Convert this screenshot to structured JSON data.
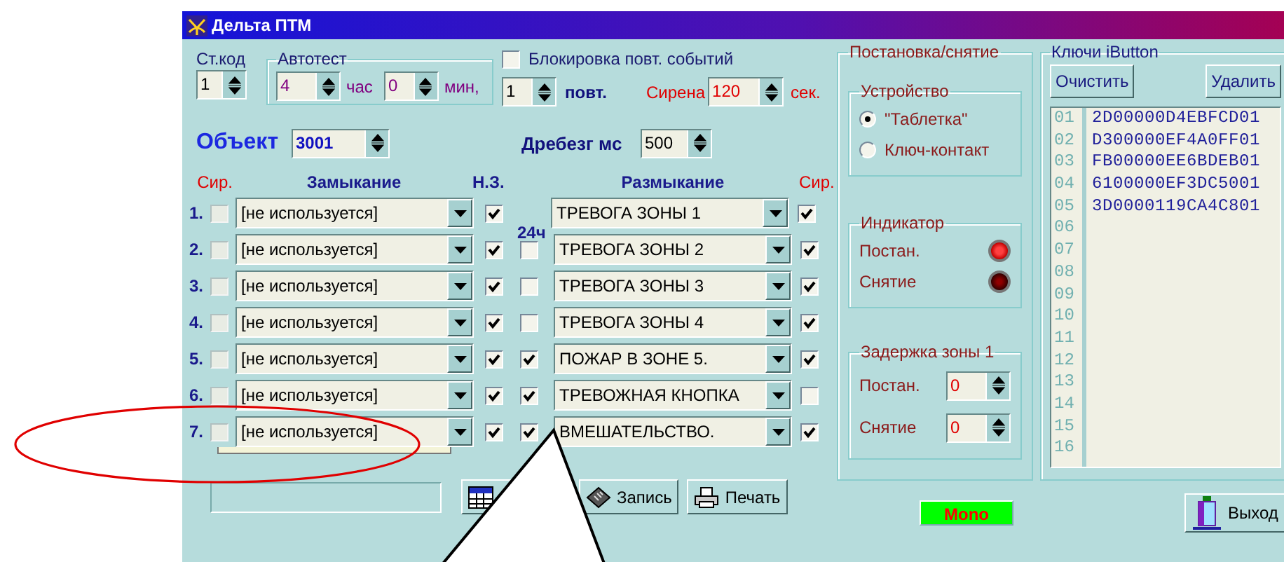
{
  "window": {
    "title": "Дельта ПТМ"
  },
  "station_code": {
    "label": "Ст.код",
    "value": "1"
  },
  "autotest": {
    "title": "Автотест",
    "hours": "4",
    "hours_unit": "час",
    "minutes": "0",
    "minutes_unit": "мин,"
  },
  "block_repeats": {
    "label": "Блокировка повт. событий",
    "checked": false
  },
  "repeats": {
    "value": "1",
    "unit": "повт."
  },
  "siren": {
    "label": "Сирена",
    "value": "120",
    "unit": "сек."
  },
  "object": {
    "label": "Объект",
    "value": "3001"
  },
  "debounce": {
    "label": "Дребезг мс",
    "value": "500"
  },
  "zones": {
    "headers": {
      "siren_closing": "Сир.",
      "closing": "Замыкание",
      "normally_closed": "Н.З.",
      "opening": "Размыкание",
      "siren_opening": "Сир.",
      "h24": "24ч"
    },
    "rows": [
      {
        "number": "1.",
        "siren_closing": false,
        "closing": "[не используется]",
        "open": false,
        "normally_closed": true,
        "opening": "ТРЕВОГА ЗОНЫ 1",
        "siren_opening": true
      },
      {
        "number": "2.",
        "siren_closing": false,
        "closing": "[не используется]",
        "open": false,
        "normally_closed": true,
        "h24": false,
        "opening": "ТРЕВОГА ЗОНЫ 2",
        "siren_opening": true
      },
      {
        "number": "3.",
        "siren_closing": false,
        "closing": "[не используется]",
        "open": false,
        "normally_closed": true,
        "h24": false,
        "opening": "ТРЕВОГА ЗОНЫ 3",
        "siren_opening": true
      },
      {
        "number": "4.",
        "siren_closing": false,
        "closing": "[не используется]",
        "open": false,
        "normally_closed": true,
        "h24": false,
        "opening": "ТРЕВОГА ЗОНЫ 4",
        "siren_opening": true
      },
      {
        "number": "5.",
        "siren_closing": false,
        "closing": "[не используется]",
        "open": false,
        "normally_closed": true,
        "h24": true,
        "opening": "ПОЖАР В ЗОНЕ 5.",
        "siren_opening": true
      },
      {
        "number": "6.",
        "siren_closing": false,
        "closing": "[не используется]",
        "open": false,
        "normally_closed": true,
        "h24": true,
        "opening": "ТРЕВОЖНАЯ КНОПКА",
        "siren_opening": false
      },
      {
        "number": "7.",
        "siren_closing": false,
        "closing": "[не используется]",
        "open": true,
        "normally_closed": true,
        "h24": true,
        "opening": "ВМЕШАТЕЛЬСТВО.",
        "siren_opening": true
      }
    ]
  },
  "toolbar": [
    {
      "kind": "table"
    },
    {
      "kind": "record",
      "label": "Запись"
    },
    {
      "kind": "print",
      "label": "Печать"
    }
  ],
  "arming": {
    "title": "Постановка/снятие",
    "device": {
      "title": "Устройство",
      "options": [
        {
          "label": "\"Таблетка\"",
          "selected": true
        },
        {
          "label": "Ключ-контакт",
          "selected": false
        }
      ]
    },
    "indicator": {
      "title": "Индикатор",
      "lamps": [
        {
          "label": "Постан.",
          "on": true
        },
        {
          "label": "Снятие",
          "on": false
        }
      ]
    },
    "zone_delay": {
      "title": "Задержка зоны 1",
      "fields": [
        {
          "label": "Постан.",
          "value": "0"
        },
        {
          "label": "Снятие",
          "value": "0"
        }
      ]
    }
  },
  "keys": {
    "title": "Ключи iButton",
    "buttons": [
      "Очистить",
      "Удалить"
    ],
    "lines": [
      {
        "number": "01",
        "code": "2D00000D4EBFCD01"
      },
      {
        "number": "02",
        "code": "D300000EF4A0FF01"
      },
      {
        "number": "03",
        "code": "FB00000EE6BDEB01"
      },
      {
        "number": "04",
        "code": "6100000EF3DC5001"
      },
      {
        "number": "05",
        "code": "3D0000119CA4C801"
      },
      {
        "number": "06"
      },
      {
        "number": "07"
      },
      {
        "number": "08"
      },
      {
        "number": "09"
      },
      {
        "number": "10"
      },
      {
        "number": "11"
      },
      {
        "number": "12"
      },
      {
        "number": "13"
      },
      {
        "number": "14"
      },
      {
        "number": "15"
      },
      {
        "number": "16"
      }
    ]
  },
  "mode": "Mono",
  "exit": "Выход"
}
